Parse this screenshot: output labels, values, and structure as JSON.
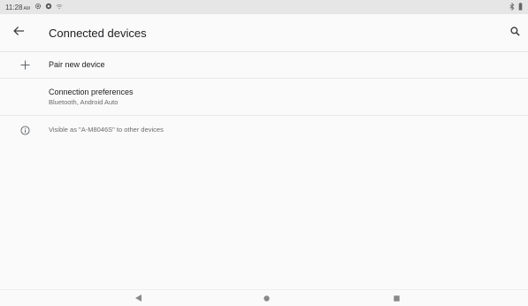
{
  "status_bar": {
    "time": "11:28",
    "ampm": "AM"
  },
  "toolbar": {
    "title": "Connected devices",
    "back_icon": "arrow-back-icon",
    "search_icon": "search-icon"
  },
  "items": [
    {
      "title": "Pair new device",
      "icon": "plus-icon"
    },
    {
      "title": "Connection preferences",
      "subtitle": "Bluetooth, Android Auto"
    },
    {
      "title": "Visible as \"A-M8046S\" to other devices",
      "icon": "info-icon"
    }
  ],
  "colors": {
    "background": "#fafafa",
    "status_bar": "#e6e6e6",
    "primary_text": "#202124",
    "secondary_text": "#6b6b6b",
    "divider": "#e8e8e8"
  }
}
